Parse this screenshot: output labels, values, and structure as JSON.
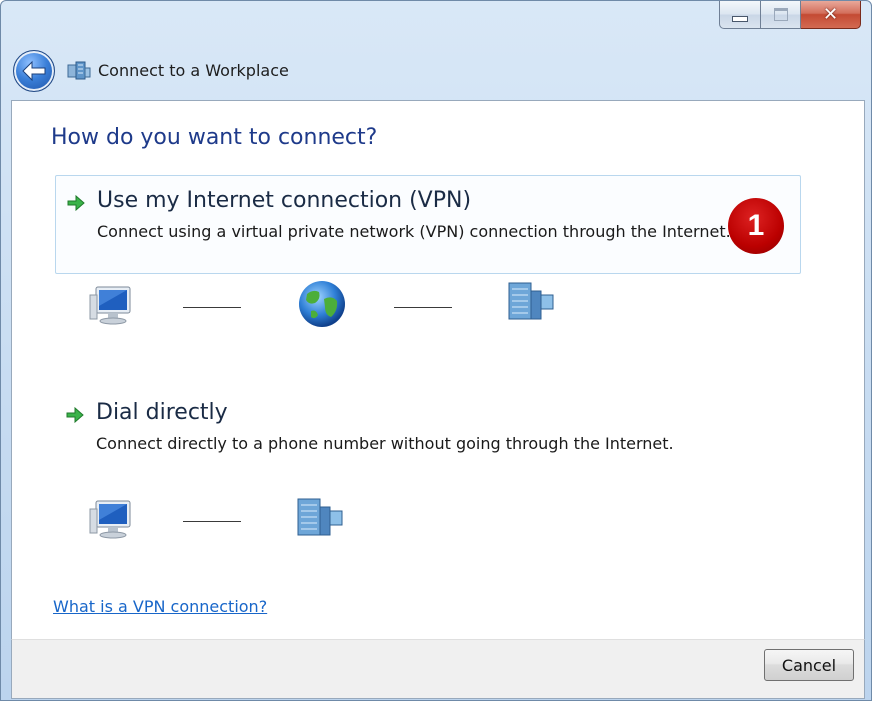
{
  "window": {
    "title": "Connect to a Workplace",
    "controls": {
      "minimize": "minimize",
      "maximize": "maximize",
      "close": "✕"
    }
  },
  "heading": "How do you want to connect?",
  "options": [
    {
      "title": "Use my Internet connection (VPN)",
      "description": "Connect using a virtual private network (VPN) connection through the Internet.",
      "selected": true,
      "diagram": [
        "computer-icon",
        "globe-icon",
        "office-building-icon"
      ]
    },
    {
      "title": "Dial directly",
      "description": "Connect directly to a phone number without going through the Internet.",
      "selected": false,
      "diagram": [
        "computer-icon",
        "office-building-icon"
      ]
    }
  ],
  "callout_badge": "1",
  "help_link": "What is a VPN connection?",
  "footer": {
    "cancel_label": "Cancel"
  },
  "colors": {
    "heading": "#1e3a8a",
    "link": "#1866c9",
    "badge": "#b00000",
    "selected_border": "#b9d7ee"
  }
}
